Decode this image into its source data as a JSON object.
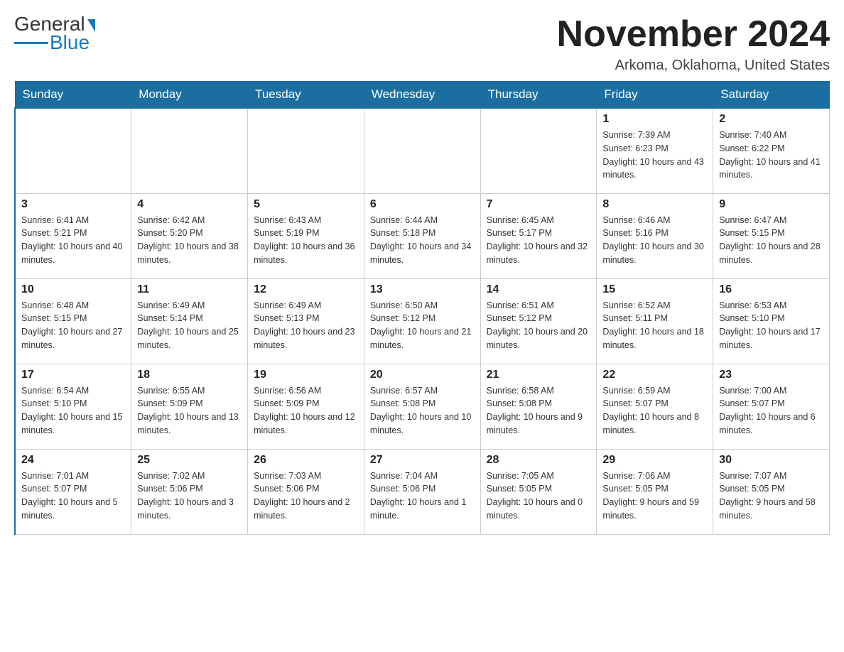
{
  "header": {
    "logo": {
      "general": "General",
      "blue": "Blue"
    },
    "title": "November 2024",
    "location": "Arkoma, Oklahoma, United States"
  },
  "days_of_week": [
    "Sunday",
    "Monday",
    "Tuesday",
    "Wednesday",
    "Thursday",
    "Friday",
    "Saturday"
  ],
  "weeks": [
    [
      {
        "day": "",
        "info": ""
      },
      {
        "day": "",
        "info": ""
      },
      {
        "day": "",
        "info": ""
      },
      {
        "day": "",
        "info": ""
      },
      {
        "day": "",
        "info": ""
      },
      {
        "day": "1",
        "info": "Sunrise: 7:39 AM\nSunset: 6:23 PM\nDaylight: 10 hours and 43 minutes."
      },
      {
        "day": "2",
        "info": "Sunrise: 7:40 AM\nSunset: 6:22 PM\nDaylight: 10 hours and 41 minutes."
      }
    ],
    [
      {
        "day": "3",
        "info": "Sunrise: 6:41 AM\nSunset: 5:21 PM\nDaylight: 10 hours and 40 minutes."
      },
      {
        "day": "4",
        "info": "Sunrise: 6:42 AM\nSunset: 5:20 PM\nDaylight: 10 hours and 38 minutes."
      },
      {
        "day": "5",
        "info": "Sunrise: 6:43 AM\nSunset: 5:19 PM\nDaylight: 10 hours and 36 minutes."
      },
      {
        "day": "6",
        "info": "Sunrise: 6:44 AM\nSunset: 5:18 PM\nDaylight: 10 hours and 34 minutes."
      },
      {
        "day": "7",
        "info": "Sunrise: 6:45 AM\nSunset: 5:17 PM\nDaylight: 10 hours and 32 minutes."
      },
      {
        "day": "8",
        "info": "Sunrise: 6:46 AM\nSunset: 5:16 PM\nDaylight: 10 hours and 30 minutes."
      },
      {
        "day": "9",
        "info": "Sunrise: 6:47 AM\nSunset: 5:15 PM\nDaylight: 10 hours and 28 minutes."
      }
    ],
    [
      {
        "day": "10",
        "info": "Sunrise: 6:48 AM\nSunset: 5:15 PM\nDaylight: 10 hours and 27 minutes."
      },
      {
        "day": "11",
        "info": "Sunrise: 6:49 AM\nSunset: 5:14 PM\nDaylight: 10 hours and 25 minutes."
      },
      {
        "day": "12",
        "info": "Sunrise: 6:49 AM\nSunset: 5:13 PM\nDaylight: 10 hours and 23 minutes."
      },
      {
        "day": "13",
        "info": "Sunrise: 6:50 AM\nSunset: 5:12 PM\nDaylight: 10 hours and 21 minutes."
      },
      {
        "day": "14",
        "info": "Sunrise: 6:51 AM\nSunset: 5:12 PM\nDaylight: 10 hours and 20 minutes."
      },
      {
        "day": "15",
        "info": "Sunrise: 6:52 AM\nSunset: 5:11 PM\nDaylight: 10 hours and 18 minutes."
      },
      {
        "day": "16",
        "info": "Sunrise: 6:53 AM\nSunset: 5:10 PM\nDaylight: 10 hours and 17 minutes."
      }
    ],
    [
      {
        "day": "17",
        "info": "Sunrise: 6:54 AM\nSunset: 5:10 PM\nDaylight: 10 hours and 15 minutes."
      },
      {
        "day": "18",
        "info": "Sunrise: 6:55 AM\nSunset: 5:09 PM\nDaylight: 10 hours and 13 minutes."
      },
      {
        "day": "19",
        "info": "Sunrise: 6:56 AM\nSunset: 5:09 PM\nDaylight: 10 hours and 12 minutes."
      },
      {
        "day": "20",
        "info": "Sunrise: 6:57 AM\nSunset: 5:08 PM\nDaylight: 10 hours and 10 minutes."
      },
      {
        "day": "21",
        "info": "Sunrise: 6:58 AM\nSunset: 5:08 PM\nDaylight: 10 hours and 9 minutes."
      },
      {
        "day": "22",
        "info": "Sunrise: 6:59 AM\nSunset: 5:07 PM\nDaylight: 10 hours and 8 minutes."
      },
      {
        "day": "23",
        "info": "Sunrise: 7:00 AM\nSunset: 5:07 PM\nDaylight: 10 hours and 6 minutes."
      }
    ],
    [
      {
        "day": "24",
        "info": "Sunrise: 7:01 AM\nSunset: 5:07 PM\nDaylight: 10 hours and 5 minutes."
      },
      {
        "day": "25",
        "info": "Sunrise: 7:02 AM\nSunset: 5:06 PM\nDaylight: 10 hours and 3 minutes."
      },
      {
        "day": "26",
        "info": "Sunrise: 7:03 AM\nSunset: 5:06 PM\nDaylight: 10 hours and 2 minutes."
      },
      {
        "day": "27",
        "info": "Sunrise: 7:04 AM\nSunset: 5:06 PM\nDaylight: 10 hours and 1 minute."
      },
      {
        "day": "28",
        "info": "Sunrise: 7:05 AM\nSunset: 5:05 PM\nDaylight: 10 hours and 0 minutes."
      },
      {
        "day": "29",
        "info": "Sunrise: 7:06 AM\nSunset: 5:05 PM\nDaylight: 9 hours and 59 minutes."
      },
      {
        "day": "30",
        "info": "Sunrise: 7:07 AM\nSunset: 5:05 PM\nDaylight: 9 hours and 58 minutes."
      }
    ]
  ]
}
